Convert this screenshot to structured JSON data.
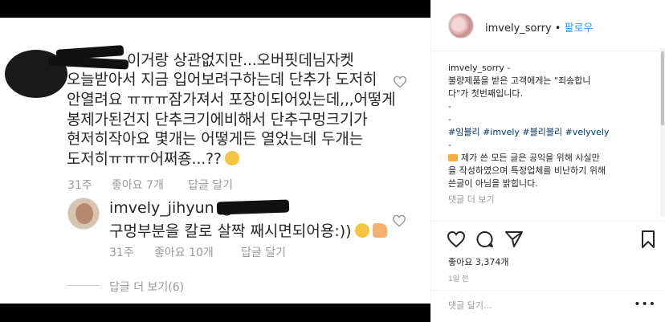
{
  "photo": {
    "comment_lines": [
      "이거랑 상관없지만...오버핏데님자켓",
      "오늘받아서 지금 입어보려구하는데 단추가 도저히",
      "안열려요 ㅠㅠㅠ잠가져서 포장이되어있는데,,,어떻게",
      "봉제가된건지 단추크기에비해서 단추구멍크기가",
      "현저히작아요 몇개는 어떻게든 열었는데 두개는",
      "도저히ㅠㅠㅠ어쩌죵...??"
    ],
    "comment_meta": {
      "time": "31주",
      "likes": "좋아요 7개",
      "reply": "답글 달기"
    },
    "reply": {
      "username": "imvely_jihyun",
      "mention": "@",
      "text": "구멍부분을 칼로 살짝 째시면되어용:))",
      "time": "31주",
      "likes": "좋아요 10개",
      "reply": "답글 달기"
    },
    "view_more": "답글 더 보기(6)"
  },
  "panel": {
    "header": {
      "username": "imvely_sorry",
      "dot": "•",
      "follow": "팔로우"
    },
    "caption": {
      "username": "imvely_sorry",
      "after_user": " -",
      "lines": [
        "불량제품을 받은 고객에게는 \"죄송합니",
        "다\"가 첫번째입니다.",
        "-",
        "-"
      ],
      "hashtags": "#임블리 #imvely #블리블리 #velyvely",
      "dash": "-",
      "notice_lines": [
        "제가 쓴 모든 글은 공익을 위해 사실만",
        "을 작성하였으며 특정업체를 비난하기 위해",
        "쓴글이 아님을 밝힙니다."
      ],
      "view_replies": "댓글 더 보기"
    },
    "likes": "좋아요 3,374개",
    "time": "1일 전",
    "comment_placeholder": "댓글 달기...",
    "more": "•••"
  },
  "colors": {
    "link": "#3897f0",
    "hashtag": "#003569",
    "muted": "#999999"
  },
  "icons": [
    "heart-icon",
    "comment-icon",
    "share-icon",
    "bookmark-icon",
    "more-options-icon"
  ]
}
